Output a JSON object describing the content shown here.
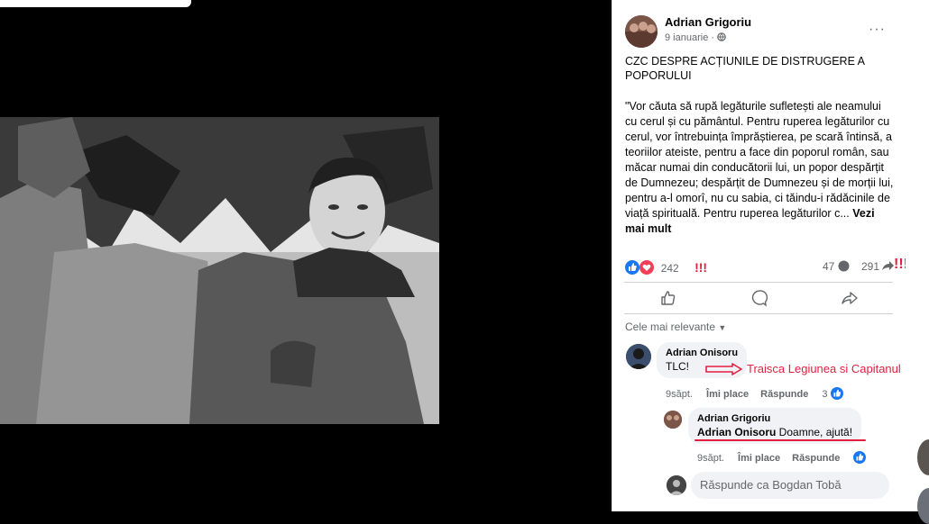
{
  "post": {
    "author": "Adrian Grigoriu",
    "date": "9 ianuarie · ",
    "privacy_icon": "globe-icon",
    "more": "···",
    "headline": "CZC DESPRE ACȚIUNILE DE DISTRUGERE A POPORULUI",
    "body": "\"Vor căuta să rupă legăturile sufletești ale neamului cu cerul și cu pământul. Pentru ruperea legăturilor cu cerul, vor întrebuința împrăștierea, pe scară întinsă, a teoriilor ateiste, pentru a face din poporul român, sau măcar numai din conducătorii lui, un popor despărțit de Dumnezeu; despărțit de Dumnezeu și de morții lui, pentru a-l omorî, nu cu sabia, ci tăindu-i rădăcinile de viață spirituală. Pentru ruperea legăturilor c...",
    "see_more": "Vezi mai mult",
    "reactions_count": "242",
    "reactions_mark": "!!!",
    "comments_count": "47",
    "shares_count": "291",
    "shares_mark": "!!!!",
    "sort_label": "Cele mai relevante"
  },
  "comments": [
    {
      "author": "Adrian Onisoru",
      "text": "TLC!",
      "time": "9săpt.",
      "like": "Îmi place",
      "reply": "Răspunde",
      "likes": "3",
      "annotation": "Traisca Legiunea si Capitanul"
    },
    {
      "author": "Adrian Grigoriu",
      "mention": "Adrian Onisoru",
      "text": " Doamne, ajută!",
      "time": "9săpt.",
      "like": "Îmi place",
      "reply": "Răspunde"
    }
  ],
  "reply_placeholder": "Răspunde ca Bogdan Tobă",
  "colors": {
    "fb_blue": "#1877f2",
    "annotation_red": "#e41e3f",
    "love_red": "#f33e58"
  }
}
